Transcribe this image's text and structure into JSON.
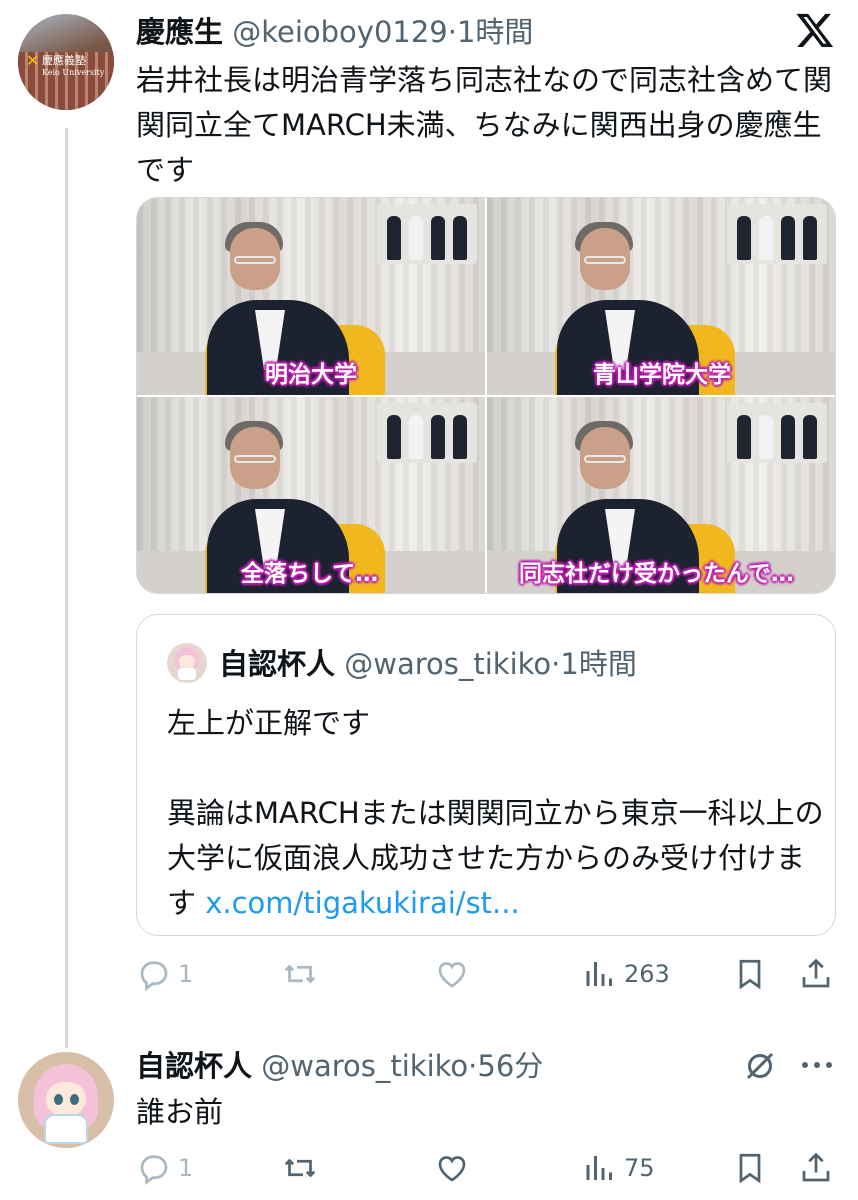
{
  "tweet": {
    "name": "慶應生",
    "handle": "@keioboy0129",
    "time": "1時間",
    "text": "岩井社長は明治青学落ち同志社なので同志社含めて関関同立全てMARCH未満、ちなみに関西出身の慶應生です",
    "avatar_text1": "慶應義塾",
    "avatar_text2": "Keio University",
    "media_captions": [
      "明治大学",
      "青山学院大学",
      "全落ちして…",
      "同志社だけ受かったんで…"
    ],
    "quote": {
      "name": "自認杯人",
      "handle": "@waros_tikiko",
      "time": "1時間",
      "line1": "左上が正解です",
      "line2": "異論はMARCHまたは関関同立から東京一科以上の大学に仮面浪人成功させた方からのみ受け付けます ",
      "link": "x.com/tigakukirai/st..."
    },
    "stats": {
      "replies": "1",
      "views": "263"
    }
  },
  "reply": {
    "name": "自認杯人",
    "handle": "@waros_tikiko",
    "time": "56分",
    "text": "誰お前",
    "stats": {
      "replies": "1",
      "views": "75"
    }
  },
  "sep": "·",
  "icons": [
    "x-logo-icon",
    "reply-icon",
    "retweet-icon",
    "like-icon",
    "views-icon",
    "bookmark-icon",
    "share-icon",
    "grok-icon",
    "more-icon"
  ],
  "colors": {
    "text": "#0f1419",
    "secondary": "#536471",
    "link": "#1d9bf0",
    "border": "#cfd9de",
    "caption_outline": "#c01fb5"
  }
}
